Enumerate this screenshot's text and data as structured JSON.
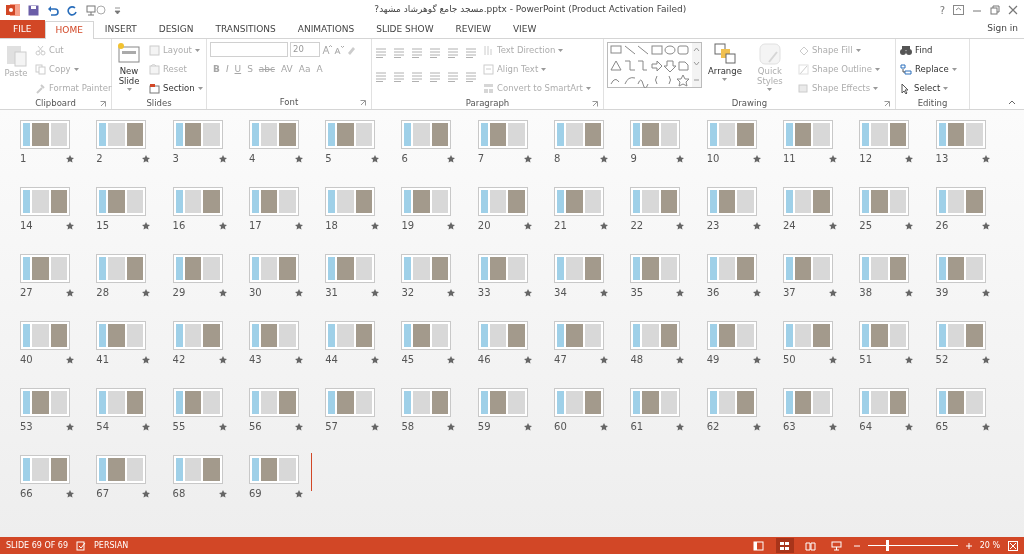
{
  "title_bar": {
    "title": "?مسجد جامع گوهرشاد مشهد.pptx - PowerPoint (Product Activation Failed)",
    "help": "?"
  },
  "tabs": [
    {
      "label": "FILE",
      "kind": "file",
      "selected": false
    },
    {
      "label": "HOME",
      "kind": "tab",
      "selected": true
    },
    {
      "label": "INSERT",
      "kind": "tab",
      "selected": false
    },
    {
      "label": "DESIGN",
      "kind": "tab",
      "selected": false
    },
    {
      "label": "TRANSITIONS",
      "kind": "tab",
      "selected": false
    },
    {
      "label": "ANIMATIONS",
      "kind": "tab",
      "selected": false
    },
    {
      "label": "SLIDE SHOW",
      "kind": "tab",
      "selected": false
    },
    {
      "label": "REVIEW",
      "kind": "tab",
      "selected": false
    },
    {
      "label": "VIEW",
      "kind": "tab",
      "selected": false
    }
  ],
  "sign_in": "Sign in",
  "ribbon": [
    {
      "label": "Clipboard",
      "columns": [
        [
          {
            "kind": "large",
            "label": "Paste",
            "disabled": true
          }
        ],
        [
          {
            "kind": "small",
            "label": "Cut",
            "disabled": true
          },
          {
            "kind": "small",
            "label": "Copy",
            "disabled": true
          },
          {
            "kind": "small",
            "label": "Format Painter",
            "disabled": true
          }
        ]
      ]
    },
    {
      "label": "Slides",
      "columns": [
        [
          {
            "kind": "large",
            "label": "New Slide",
            "disabled": false
          }
        ],
        [
          {
            "kind": "small",
            "label": "Layout",
            "disabled": true
          },
          {
            "kind": "small",
            "label": "Reset",
            "disabled": true
          },
          {
            "kind": "small",
            "label": "Section",
            "disabled": false
          }
        ]
      ]
    },
    {
      "label": "Font",
      "columns": [
        [
          {
            "kind": "fontfields",
            "size": "20",
            "disabled": true
          },
          {
            "kind": "toolrow",
            "buttons": [
              "B",
              "I",
              "U",
              "S",
              "abc",
              "AV",
              "Aa",
              "A"
            ],
            "disabled": true
          }
        ]
      ]
    },
    {
      "label": "Paragraph",
      "columns": [
        [
          {
            "kind": "iconrow",
            "disabled": true
          },
          {
            "kind": "iconrow",
            "disabled": true
          }
        ],
        [
          {
            "kind": "small",
            "label": "Text Direction",
            "disabled": true
          },
          {
            "kind": "small",
            "label": "Align Text",
            "disabled": true
          },
          {
            "kind": "small",
            "label": "Convert to SmartArt",
            "disabled": true
          }
        ]
      ]
    },
    {
      "label": "Drawing",
      "columns": [
        [
          {
            "kind": "gallery",
            "disabled": false
          }
        ],
        [
          {
            "kind": "large",
            "label": "Arrange",
            "disabled": false
          }
        ],
        [
          {
            "kind": "large",
            "label": "Quick Styles",
            "disabled": true
          }
        ],
        [
          {
            "kind": "small",
            "label": "Shape Fill",
            "disabled": true
          },
          {
            "kind": "small",
            "label": "Shape Outline",
            "disabled": true
          },
          {
            "kind": "small",
            "label": "Shape Effects",
            "disabled": true
          }
        ]
      ]
    },
    {
      "label": "Editing",
      "columns": [
        [
          {
            "kind": "small",
            "label": "Find",
            "disabled": false
          },
          {
            "kind": "small",
            "label": "Replace",
            "disabled": false
          },
          {
            "kind": "small",
            "label": "Select",
            "disabled": false
          }
        ]
      ]
    }
  ],
  "slides": [
    {
      "number": "1",
      "transition": true
    },
    {
      "number": "2",
      "transition": true
    },
    {
      "number": "3",
      "transition": true
    },
    {
      "number": "4",
      "transition": true
    },
    {
      "number": "5",
      "transition": true
    },
    {
      "number": "6",
      "transition": true
    },
    {
      "number": "7",
      "transition": true
    },
    {
      "number": "8",
      "transition": true
    },
    {
      "number": "9",
      "transition": true
    },
    {
      "number": "10",
      "transition": true
    },
    {
      "number": "11",
      "transition": true
    },
    {
      "number": "12",
      "transition": true
    },
    {
      "number": "13",
      "transition": true
    },
    {
      "number": "14",
      "transition": true
    },
    {
      "number": "15",
      "transition": true
    },
    {
      "number": "16",
      "transition": true
    },
    {
      "number": "17",
      "transition": true
    },
    {
      "number": "18",
      "transition": true
    },
    {
      "number": "19",
      "transition": true
    },
    {
      "number": "20",
      "transition": true
    },
    {
      "number": "21",
      "transition": true
    },
    {
      "number": "22",
      "transition": true
    },
    {
      "number": "23",
      "transition": true
    },
    {
      "number": "24",
      "transition": true
    },
    {
      "number": "25",
      "transition": true
    },
    {
      "number": "26",
      "transition": true
    },
    {
      "number": "27",
      "transition": true
    },
    {
      "number": "28",
      "transition": true
    },
    {
      "number": "29",
      "transition": true
    },
    {
      "number": "30",
      "transition": true
    },
    {
      "number": "31",
      "transition": true
    },
    {
      "number": "32",
      "transition": true
    },
    {
      "number": "33",
      "transition": true
    },
    {
      "number": "34",
      "transition": true
    },
    {
      "number": "35",
      "transition": true
    },
    {
      "number": "36",
      "transition": true
    },
    {
      "number": "37",
      "transition": true
    },
    {
      "number": "38",
      "transition": true
    },
    {
      "number": "39",
      "transition": true
    },
    {
      "number": "40",
      "transition": true
    },
    {
      "number": "41",
      "transition": true
    },
    {
      "number": "42",
      "transition": true
    },
    {
      "number": "43",
      "transition": true
    },
    {
      "number": "44",
      "transition": true
    },
    {
      "number": "45",
      "transition": true
    },
    {
      "number": "46",
      "transition": true
    },
    {
      "number": "47",
      "transition": true
    },
    {
      "number": "48",
      "transition": true
    },
    {
      "number": "49",
      "transition": true
    },
    {
      "number": "50",
      "transition": true
    },
    {
      "number": "51",
      "transition": true
    },
    {
      "number": "52",
      "transition": true
    },
    {
      "number": "53",
      "transition": true
    },
    {
      "number": "54",
      "transition": true
    },
    {
      "number": "55",
      "transition": true
    },
    {
      "number": "56",
      "transition": true
    },
    {
      "number": "57",
      "transition": true
    },
    {
      "number": "58",
      "transition": true
    },
    {
      "number": "59",
      "transition": true
    },
    {
      "number": "60",
      "transition": true
    },
    {
      "number": "61",
      "transition": true
    },
    {
      "number": "62",
      "transition": true
    },
    {
      "number": "63",
      "transition": true
    },
    {
      "number": "64",
      "transition": true
    },
    {
      "number": "65",
      "transition": true
    },
    {
      "number": "66",
      "transition": true
    },
    {
      "number": "67",
      "transition": true
    },
    {
      "number": "68",
      "transition": true
    },
    {
      "number": "69",
      "transition": true
    }
  ],
  "status_bar": {
    "slide_info": "SLIDE 69 OF 69",
    "language": "PERSIAN",
    "views": [
      {
        "selected": false
      },
      {
        "selected": true
      },
      {
        "selected": false
      },
      {
        "selected": false
      }
    ],
    "zoom": {
      "level": 0.2,
      "reading": "20 %"
    }
  }
}
